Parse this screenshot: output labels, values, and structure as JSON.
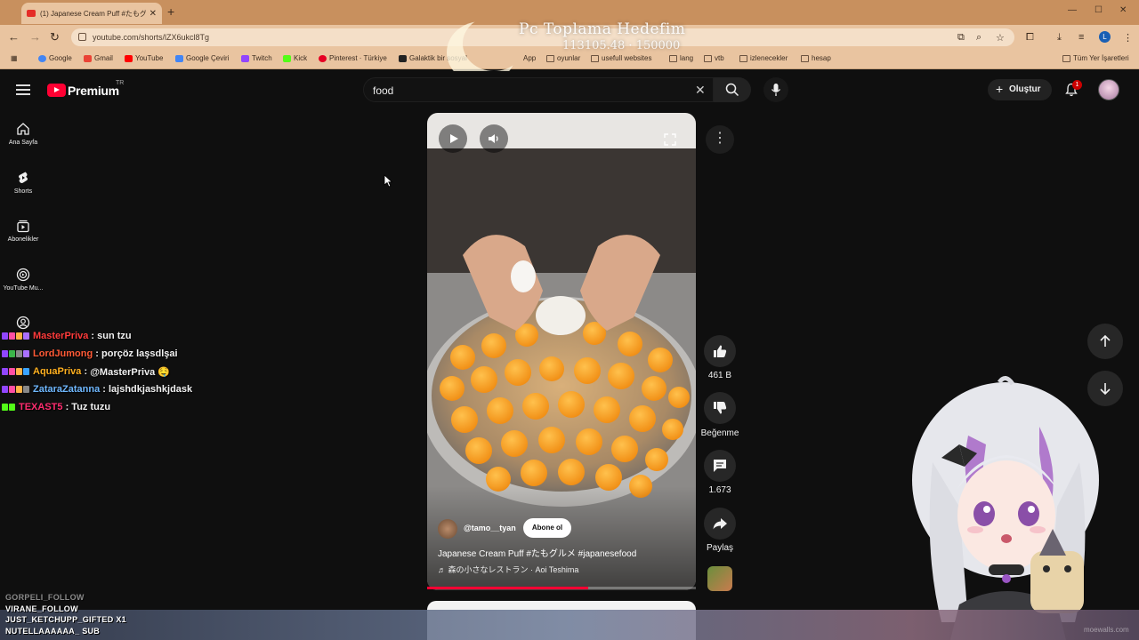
{
  "browser": {
    "tab_title": "(1) Japanese Cream Puff #たもグル",
    "url": "youtube.com/shorts/lZX6ukcl8Tg",
    "bookmarks": [
      "Google",
      "Gmail",
      "YouTube",
      "Google Çeviri",
      "Twitch",
      "Kick",
      "Pinterest · Türkiye",
      "Galaktik bir sosyal",
      "App",
      "oyunlar",
      "usefull websites",
      "lang",
      "vtb",
      "izlenecekler",
      "hesap"
    ],
    "all_bookmarks": "Tüm Yer İşaretleri",
    "profile_initial": "L",
    "colors": {
      "tabbar": "#c8905e",
      "toolbar": "#e9c4a0"
    }
  },
  "overlay": {
    "goal_title": "Pc Toplama Hedefim",
    "goal_progress": "113105.48 · 150000"
  },
  "youtube": {
    "brand": "Premium",
    "region": "TR",
    "search_query": "food",
    "create_label": "Oluştur",
    "notification_count": "1",
    "guide": [
      {
        "label": "Ana Sayfa",
        "icon": "home-icon"
      },
      {
        "label": "Shorts",
        "icon": "shorts-icon"
      },
      {
        "label": "Abonelikler",
        "icon": "subscriptions-icon"
      },
      {
        "label": "YouTube Mu...",
        "icon": "youtube-music-icon"
      }
    ]
  },
  "chat": [
    {
      "user": "MasterPriva",
      "message": "sun tzu",
      "color": "#ff3b3b"
    },
    {
      "user": "LordJumong",
      "message": "porçöz laşsdlşai",
      "color": "#ff5a36"
    },
    {
      "user": "AquaPriva",
      "message": "@MasterPriva 🤤",
      "color": "#ffb020"
    },
    {
      "user": "ZataraZatanna",
      "message": "lajshdkjashkjdask",
      "color": "#6fb8ff"
    },
    {
      "user": "TEXAST5",
      "message": "Tuz tuzu",
      "color": "#ff2d6f"
    }
  ],
  "short": {
    "channel": "@tamo__tyan",
    "subscribe_label": "Abone ol",
    "title": "Japanese Cream Puff #たもグルメ #japanesefood",
    "music": "♬ 森の小さなレストラン · Aoi Teshima",
    "progress": 0.6,
    "likes": "461 B",
    "dislike_label": "Beğenme",
    "comments": "1.673",
    "share_label": "Paylaş"
  },
  "alerts": [
    "GORPELI_FOLLOW",
    "VIRANE_FOLLOW",
    "JUST_KETCHUPP_GIFTED X1",
    "NUTELLAAAAAA_ SUB"
  ],
  "watermark": "moewalls.com"
}
